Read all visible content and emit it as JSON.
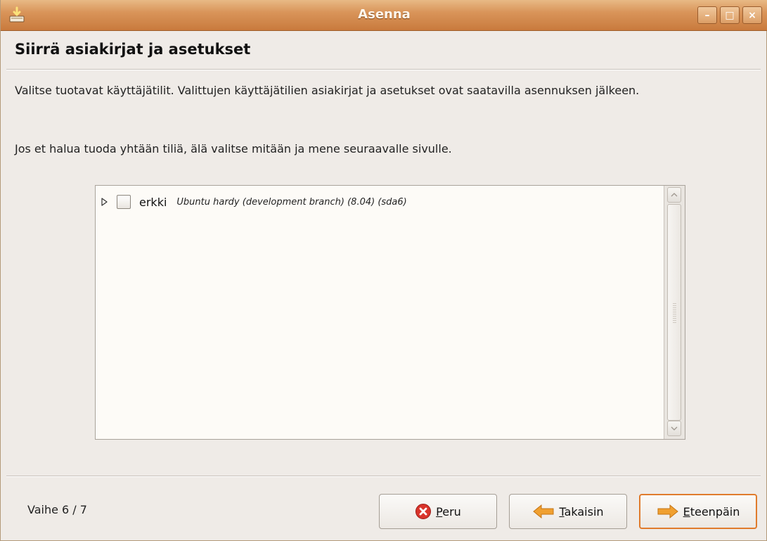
{
  "window": {
    "title": "Asenna",
    "icon": "installer-icon",
    "controls": [
      {
        "name": "minimize-button",
        "icon": "minimize-icon",
        "glyph": "–"
      },
      {
        "name": "maximize-button",
        "icon": "maximize-icon",
        "glyph": "□"
      },
      {
        "name": "close-button",
        "icon": "close-icon",
        "glyph": "×"
      }
    ]
  },
  "page": {
    "title": "Siirrä asiakirjat ja asetukset",
    "description_1": "Valitse tuotavat käyttäjätilit. Valittujen käyttäjätilien asiakirjat ja asetukset ovat saatavilla asennuksen jälkeen.",
    "description_2": "Jos et halua tuoda yhtään tiliä, älä valitse mitään ja mene seuraavalle sivulle."
  },
  "accounts": [
    {
      "name": "erkki",
      "description": "Ubuntu hardy (development branch) (8.04) (sda6)",
      "checked": false,
      "expanded": false
    }
  ],
  "footer": {
    "step": "Vaihe 6 / 7",
    "buttons": {
      "cancel": {
        "mnemonic": "P",
        "rest": "eru",
        "icon": "cancel-icon",
        "color": "#d9342b"
      },
      "back": {
        "mnemonic": "T",
        "rest": "akaisin",
        "icon": "arrow-left-icon",
        "color": "#f0a030"
      },
      "forward": {
        "mnemonic": "E",
        "rest": "teenpäin",
        "icon": "arrow-right-icon",
        "color": "#f0a030"
      }
    }
  },
  "colors": {
    "titlebar": "#d9955a",
    "accent": "#e07b2c",
    "background": "#efebe7"
  }
}
